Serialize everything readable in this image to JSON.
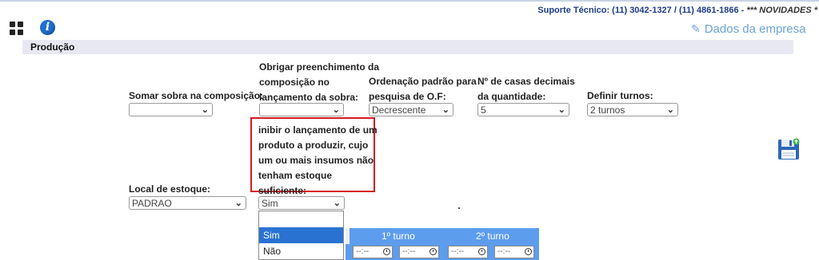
{
  "header": {
    "support_text": "Suporte Técnico: (11) 3042-1327 / (11) 4861-1866 - ",
    "novidades_text": "*** NOVIDADES *",
    "company_link_label": "Dados da empresa"
  },
  "section": {
    "title": "Produção"
  },
  "fields": {
    "somar_sobra": {
      "label": "Somar sobra na composição:",
      "value": ""
    },
    "obrigar_preenchimento": {
      "label_lines": [
        "Obrigar preenchimento da",
        "composição no",
        "lançamento da sobra:"
      ],
      "value": ""
    },
    "ordenacao_padrao": {
      "label_lines": [
        "Ordenação padrão para",
        "pesquisa de O.F:"
      ],
      "value": "Decrescente"
    },
    "casas_decimais": {
      "label_lines": [
        "Nº de casas decimais",
        "da quantidade:"
      ],
      "value": "5"
    },
    "definir_turnos": {
      "label": "Definir turnos:",
      "value": "2 turnos"
    },
    "local_estoque": {
      "label": "Local de estoque:",
      "value": "PADRAO"
    },
    "inibir_lancamento": {
      "label_lines": [
        "inibir o lançamento de um",
        "produto a produzir, cujo",
        "um ou mais insumos não",
        "tenham estoque",
        "suficiente:"
      ],
      "value": "Sim"
    }
  },
  "dropdown": {
    "options": [
      "",
      "Sim",
      "Não"
    ],
    "highlighted": "Sim"
  },
  "turnos": {
    "columns": [
      "1º turno",
      "2º turno"
    ],
    "time_placeholder": "--:--"
  },
  "colors": {
    "accent": "#2a72d2",
    "header_blue": "#5d9ded",
    "highlight_border": "#d51920",
    "support_text": "#1d3b8a",
    "link": "#6aa2d8"
  },
  "icons": {
    "apps": "grid-apps-icon",
    "info": "info-icon",
    "edit": "edit-icon",
    "save": "save-floppy-icon",
    "clock": "clock-icon",
    "chevron": "chevron-down-icon"
  }
}
